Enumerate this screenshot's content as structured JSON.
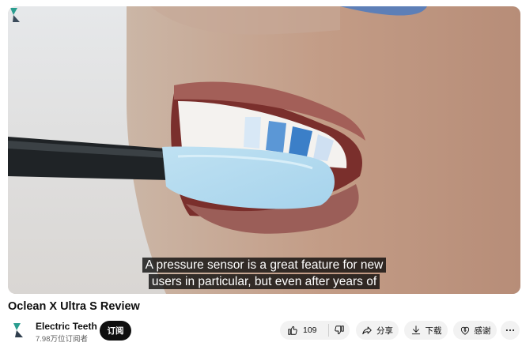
{
  "video": {
    "title": "Oclean X Ultra S Review",
    "caption_line1": "A pressure sensor is a great feature for new",
    "caption_line2": "users in particular, but even after years of"
  },
  "channel": {
    "name": "Electric Teeth",
    "subscribers": "7.98万位订阅者",
    "subscribe_label": "订阅"
  },
  "actions": {
    "like_count": "109",
    "share_label": "分享",
    "download_label": "下载",
    "thanks_label": "感谢"
  },
  "icons": {
    "like": "thumbs-up-icon",
    "dislike": "thumbs-down-icon",
    "share": "share-arrow-icon",
    "download": "download-icon",
    "thanks": "dollar-heart-icon",
    "more": "more-horizontal-icon"
  },
  "colors": {
    "subscribe_bg": "#0f0f0f",
    "pill_bg": "#f2f2f2",
    "caption_bg": "#080808"
  }
}
